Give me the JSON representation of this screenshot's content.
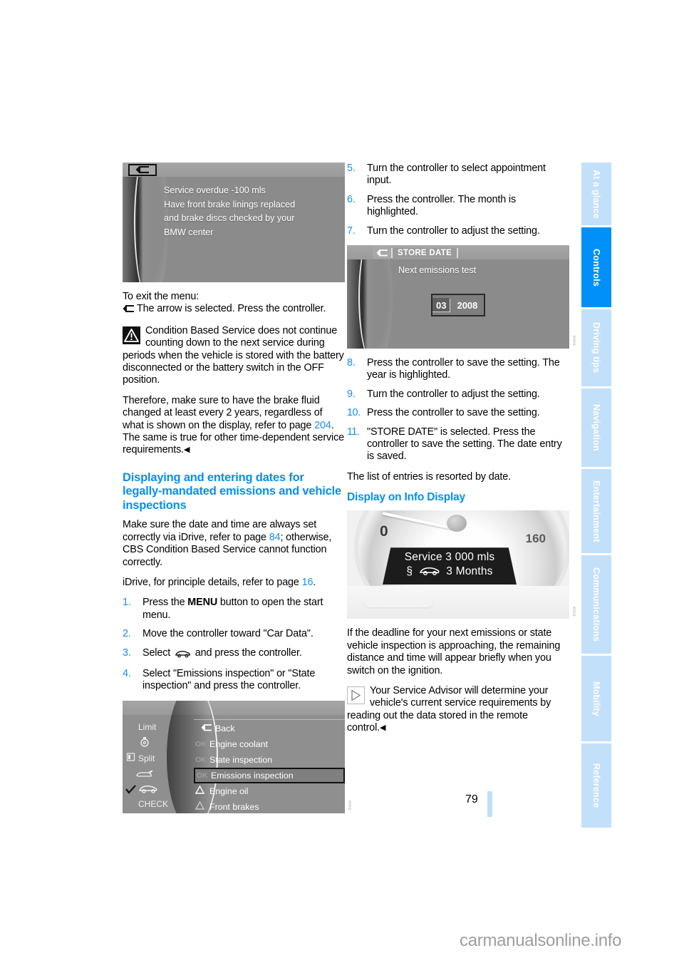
{
  "document": {
    "page_number": "79",
    "watermark": "carmanualsonline.info"
  },
  "sidebar": {
    "tabs": [
      {
        "label": "At a glance",
        "active": false
      },
      {
        "label": "Controls",
        "active": true
      },
      {
        "label": "Driving tips",
        "active": false
      },
      {
        "label": "Navigation",
        "active": false
      },
      {
        "label": "Entertainment",
        "active": false
      },
      {
        "label": "Communications",
        "active": false
      },
      {
        "label": "Mobility",
        "active": false
      },
      {
        "label": "Reference",
        "active": false
      }
    ],
    "active_color": "#0090f8",
    "inactive_color": "#c3e0fa"
  },
  "left_column": {
    "figure_service_overdue": {
      "message_lines": [
        "Service overdue -100 mls",
        "Have front brake linings replaced",
        "and brake discs checked by your",
        "BMW center"
      ],
      "back_button_icon": "back-arrow-icon"
    },
    "exit_heading": "To exit the menu:",
    "exit_text": "The arrow is selected. Press the controller.",
    "warning_note": "Condition Based Service does not continue counting down to the next service during periods when the vehicle is stored with the battery disconnected or the battery switch in the OFF position.",
    "warning_followup_pre": "Therefore, make sure to have the brake fluid changed at least every 2 years, regardless of what is shown on the display, refer to page ",
    "warning_followup_ref": "204",
    "warning_followup_post": ". The same is true for other time-dependent service requirements.",
    "section_heading": "Displaying and entering dates for legally-mandated emissions and vehicle inspections",
    "para_datetime_pre": "Make sure the date and time are always set correctly via iDrive, refer to page ",
    "para_datetime_ref": "84",
    "para_datetime_post": "; otherwise, CBS Condition Based Service cannot function correctly.",
    "para_idrive_pre": "iDrive, for principle details, refer to page ",
    "para_idrive_ref": "16",
    "para_idrive_post": ".",
    "steps": [
      {
        "num": "1.",
        "pre": "Press the ",
        "bold": "MENU",
        "post": " button to open the start menu."
      },
      {
        "num": "2.",
        "pre": "Move the controller toward \"Car Data\".",
        "bold": "",
        "post": ""
      },
      {
        "num": "3.",
        "pre": "Select ",
        "bold": "",
        "post": " and press the controller."
      },
      {
        "num": "4.",
        "pre": "Select \"Emissions inspection\" or \"State inspection\" and press the controller.",
        "bold": "",
        "post": ""
      }
    ],
    "figure_idrive_menu": {
      "left_items": [
        "Limit",
        "Split",
        "CHECK"
      ],
      "rows": [
        {
          "prefix": "",
          "icon": "back-arrow-icon",
          "label": "Back",
          "selected": false
        },
        {
          "prefix": "OK",
          "icon": "",
          "label": "Engine coolant",
          "selected": false
        },
        {
          "prefix": "OK",
          "icon": "",
          "label": "State inspection",
          "selected": false
        },
        {
          "prefix": "OK",
          "icon": "",
          "label": "Emissions inspection",
          "selected": true
        },
        {
          "prefix": "",
          "icon": "warning-triangle-icon",
          "label": "Engine oil",
          "selected": false
        },
        {
          "prefix": "",
          "icon": "warning-triangle-icon",
          "label": "Front brakes",
          "selected": false
        }
      ]
    }
  },
  "right_column": {
    "steps_top": [
      {
        "num": "5.",
        "text": "Turn the controller to select appointment input."
      },
      {
        "num": "6.",
        "text": "Press the controller. The month is highlighted."
      },
      {
        "num": "7.",
        "text": "Turn the controller to adjust the setting."
      }
    ],
    "figure_store_date": {
      "back_button_icon": "back-arrow-icon",
      "title": "STORE DATE",
      "label": "Next  emissions test",
      "month": "03",
      "year": "2008"
    },
    "steps_bottom": [
      {
        "num": "8.",
        "text": "Press the controller to save the setting. The year is highlighted."
      },
      {
        "num": "9.",
        "text": "Turn the controller to adjust the setting."
      },
      {
        "num": "10.",
        "text": "Press the controller to save the setting."
      },
      {
        "num": "11.",
        "text": "\"STORE DATE\" is selected. Press the controller to save the setting. The date entry is saved."
      }
    ],
    "resort_note": "The list of entries is resorted by date.",
    "subheading": "Display on Info Display",
    "figure_info_display": {
      "scale_min": "0",
      "scale_max": "160",
      "line1": "Service  3 000 mls",
      "line2_prefix": "§",
      "line2": "3 Months",
      "car_icon": "car-side-icon"
    },
    "para_deadline": "If the deadline for your next emissions or state vehicle inspection is approaching, the remaining distance and time will appear briefly when you switch on the ignition.",
    "advisor_note": "Your Service Advisor will determine your vehicle's current service requirements by reading out the data stored in the remote control.",
    "end_mark": "◀"
  }
}
